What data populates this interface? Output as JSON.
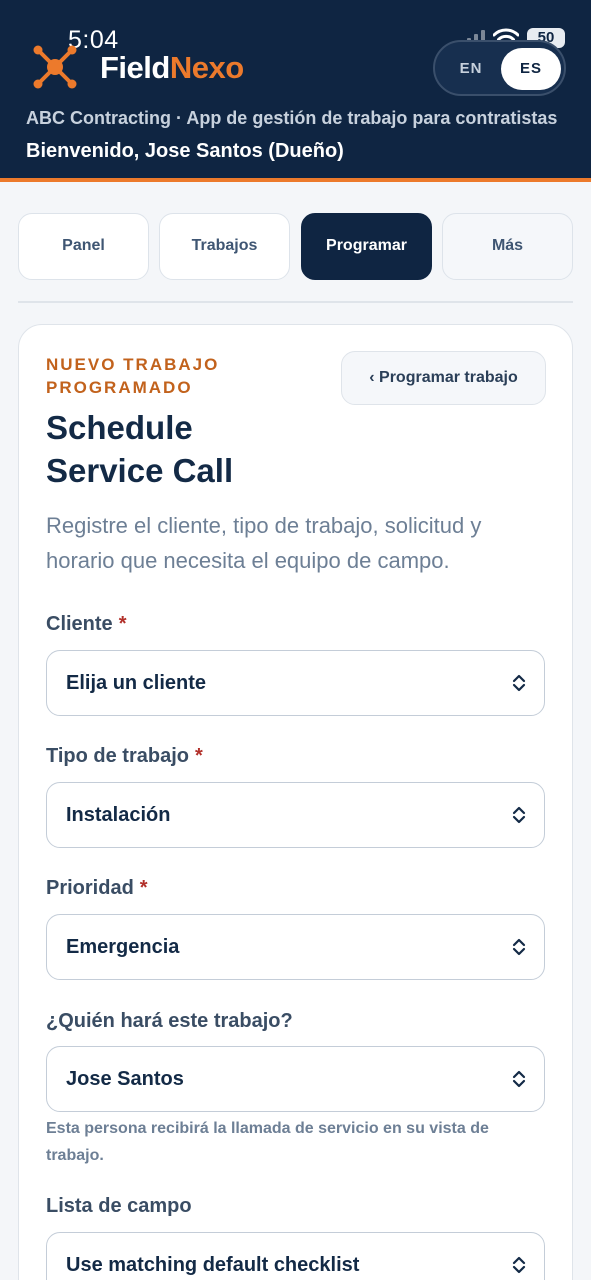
{
  "status_bar": {
    "time": "5:04",
    "battery": "50"
  },
  "brand": {
    "name_part1": "Field",
    "name_part2": "Nexo",
    "accent_color": "#ec7a2c",
    "header_color": "#0f2542"
  },
  "language": {
    "en": "EN",
    "es": "ES",
    "selected": "ES"
  },
  "header": {
    "company_line": "ABC Contracting · App de gestión de trabajo para contratistas",
    "welcome": "Bienvenido, Jose Santos (Dueño)"
  },
  "tabs": [
    {
      "label": "Panel"
    },
    {
      "label": "Trabajos"
    },
    {
      "label": "Programar",
      "active": true
    },
    {
      "label": "Más"
    }
  ],
  "form": {
    "eyebrow": "NUEVO TRABAJO PROGRAMADO",
    "back_button": "‹ Programar trabajo",
    "title": "Schedule Service Call",
    "description": "Registre el cliente, tipo de trabajo, solicitud y horario que necesita el equipo de campo.",
    "required_mark": "*",
    "fields": [
      {
        "label": "Cliente",
        "required": true,
        "value": "Elija un cliente"
      },
      {
        "label": "Tipo de trabajo",
        "required": true,
        "value": "Instalación"
      },
      {
        "label": "Prioridad",
        "required": true,
        "value": "Emergencia"
      },
      {
        "label": "¿Quién hará este trabajo?",
        "required": false,
        "value": "Jose Santos"
      },
      {
        "label": "Lista de campo",
        "required": false,
        "value": "Use matching default checklist"
      }
    ],
    "assignee_helper": "Esta persona recibirá la llamada de servicio en su vista de trabajo."
  }
}
